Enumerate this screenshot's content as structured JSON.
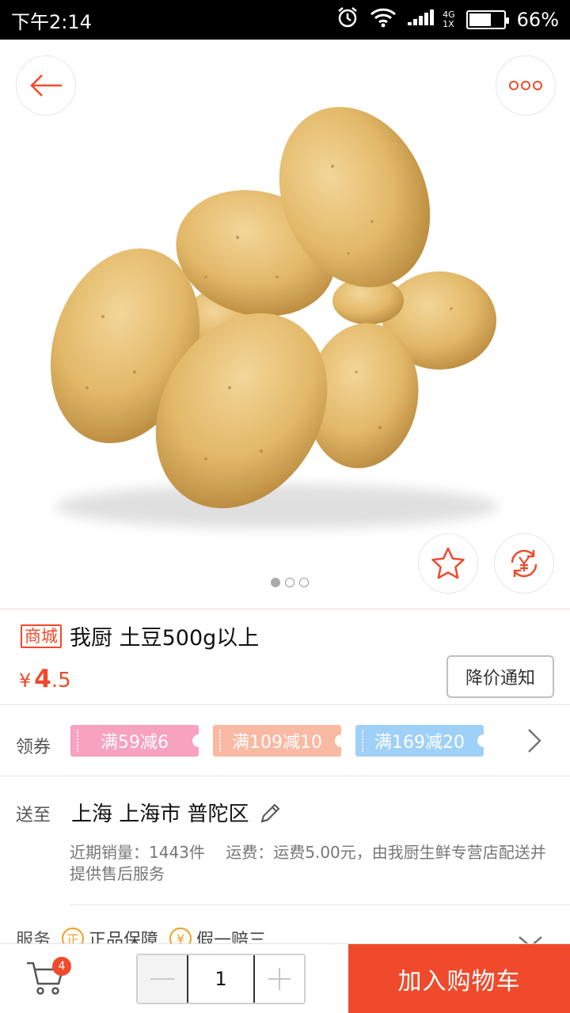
{
  "status_bar": {
    "time": "下午2:14",
    "network_top": "4G",
    "network_bottom": "1X",
    "battery": "66%",
    "battery_level": 0.66
  },
  "product": {
    "tag": "商城",
    "title": "我厨 土豆500g以上",
    "price_currency": "¥",
    "price_int": "4",
    "price_dec": ".5",
    "notify_label": "降价通知",
    "image_count": 3,
    "image_active": 1
  },
  "coupons": {
    "label": "领券",
    "items": [
      {
        "text": "满59减6",
        "color": "#f7a2bf"
      },
      {
        "text": "满109减10",
        "color": "#f9b9a3"
      },
      {
        "text": "满169减20",
        "color": "#9fd0f7"
      }
    ]
  },
  "delivery": {
    "label": "送至",
    "address": "上海 上海市 普陀区",
    "info": "近期销量：1443件　 运费：运费5.00元，由我厨生鲜专营店配送并提供售后服务"
  },
  "service": {
    "label": "服务",
    "items": [
      {
        "icon": "正",
        "text": "正品保障"
      },
      {
        "icon": "¥",
        "text": "假一赔三"
      }
    ]
  },
  "bottom": {
    "cart_badge": "4",
    "quantity": "1",
    "add_to_cart": "加入购物车"
  },
  "colors": {
    "accent": "#f04a2c"
  }
}
